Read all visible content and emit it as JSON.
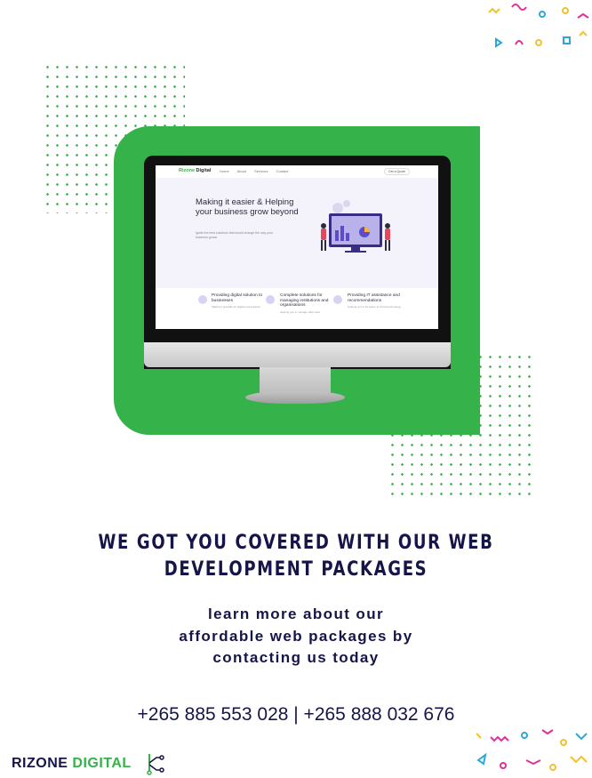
{
  "screen": {
    "brand_a": "Rizone",
    "brand_b": " Digital",
    "nav_links": [
      "Home",
      "About",
      "Services",
      "Contact"
    ],
    "cta": "Get a Quote",
    "hero_title": "Making it easier & Helping your business grow beyond",
    "hero_sub": "Ignite the best solutions that would change the way your business grows",
    "features": [
      {
        "title": "Providing digital solution to businesses",
        "sub": "Making it possible for digital incorporation"
      },
      {
        "title": "Complete solutions for managing institutions and organisations",
        "sub": "Helping you to manage daily work"
      },
      {
        "title": "Providing IT assistance and recommendations",
        "sub": "Helping you to be better at critical technology"
      }
    ]
  },
  "headline": "WE GOT YOU COVERED WITH OUR WEB DEVELOPMENT PACKAGES",
  "subtext": [
    "learn more about our",
    "affordable web packages by",
    "contacting us today"
  ],
  "phone": "+265 885 553 028 | +265 888 032 676",
  "logo": {
    "part1": "RIZONE ",
    "part2": "DIGITAL"
  },
  "colors": {
    "green": "#35b24a",
    "navy": "#15154a"
  }
}
